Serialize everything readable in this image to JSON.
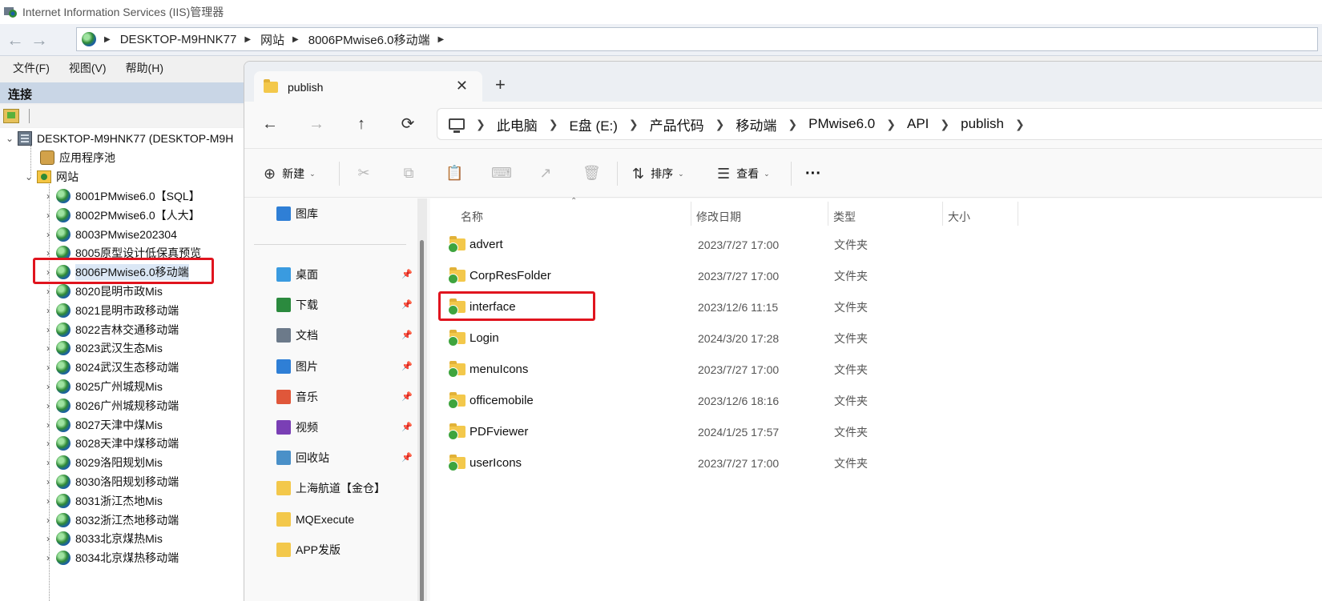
{
  "iis": {
    "title": "Internet Information Services (IIS)管理器",
    "address": {
      "segments": [
        "DESKTOP-M9HNK77",
        "网站",
        "8006PMwise6.0移动端"
      ]
    },
    "menu": [
      "文件(F)",
      "视图(V)",
      "帮助(H)"
    ],
    "connections_header": "连接",
    "tree": {
      "server": "DESKTOP-M9HNK77 (DESKTOP-M9H",
      "app_pools": "应用程序池",
      "sites_folder": "网站",
      "sites": [
        "8001PMwise6.0【SQL】",
        "8002PMwise6.0【人大】",
        "8003PMwise202304",
        "8005原型设计低保真预览",
        "8006PMwise6.0移动端",
        "8020昆明市政Mis",
        "8021昆明市政移动端",
        "8022吉林交通移动端",
        "8023武汉生态Mis",
        "8024武汉生态移动端",
        "8025广州城规Mis",
        "8026广州城规移动端",
        "8027天津中煤Mis",
        "8028天津中煤移动端",
        "8029洛阳规划Mis",
        "8030洛阳规划移动端",
        "8031浙江杰地Mis",
        "8032浙江杰地移动端",
        "8033北京煤热Mis",
        "8034北京煤热移动端"
      ],
      "selected_index": 4
    }
  },
  "explorer": {
    "tab_title": "publish",
    "breadcrumb": [
      "此电脑",
      "E盘 (E:)",
      "产品代码",
      "移动端",
      "PMwise6.0",
      "API",
      "publish"
    ],
    "commands": {
      "new": "新建",
      "sort": "排序",
      "view": "查看"
    },
    "nav_pane": {
      "gallery": "图库",
      "quick_access": [
        {
          "label": "桌面",
          "icon": "desktop-icon",
          "color": "#3a9be0",
          "pinned": true
        },
        {
          "label": "下载",
          "icon": "download-icon",
          "color": "#2b8a3e",
          "pinned": true
        },
        {
          "label": "文档",
          "icon": "document-icon",
          "color": "#6c7a8a",
          "pinned": true
        },
        {
          "label": "图片",
          "icon": "pictures-icon",
          "color": "#2f7fd6",
          "pinned": true
        },
        {
          "label": "音乐",
          "icon": "music-icon",
          "color": "#e0573a",
          "pinned": true
        },
        {
          "label": "视频",
          "icon": "video-icon",
          "color": "#7a3fb5",
          "pinned": true
        },
        {
          "label": "回收站",
          "icon": "recycle-bin-icon",
          "color": "#4a90c8",
          "pinned": true
        },
        {
          "label": "上海航道【金仓】",
          "icon": "folder-icon",
          "color": "#f3c84b",
          "pinned": false
        },
        {
          "label": "MQExecute",
          "icon": "folder-icon",
          "color": "#f3c84b",
          "pinned": false
        },
        {
          "label": "APP发版",
          "icon": "folder-icon",
          "color": "#f3c84b",
          "pinned": false
        }
      ]
    },
    "columns": {
      "name": "名称",
      "modified": "修改日期",
      "type": "类型",
      "size": "大小"
    },
    "files": [
      {
        "name": "advert",
        "modified": "2023/7/27 17:00",
        "type": "文件夹"
      },
      {
        "name": "CorpResFolder",
        "modified": "2023/7/27 17:00",
        "type": "文件夹"
      },
      {
        "name": "interface",
        "modified": "2023/12/6 11:15",
        "type": "文件夹"
      },
      {
        "name": "Login",
        "modified": "2024/3/20 17:28",
        "type": "文件夹"
      },
      {
        "name": "menuIcons",
        "modified": "2023/7/27 17:00",
        "type": "文件夹"
      },
      {
        "name": "officemobile",
        "modified": "2023/12/6 18:16",
        "type": "文件夹"
      },
      {
        "name": "PDFviewer",
        "modified": "2024/1/25 17:57",
        "type": "文件夹"
      },
      {
        "name": "userIcons",
        "modified": "2023/7/27 17:00",
        "type": "文件夹"
      }
    ],
    "highlighted_file_index": 2
  },
  "colors": {
    "highlight_border": "#e0141e",
    "folder": "#f3c84b",
    "sync_badge": "#3ea43e",
    "connections_header_bg": "#c9d6e6"
  }
}
